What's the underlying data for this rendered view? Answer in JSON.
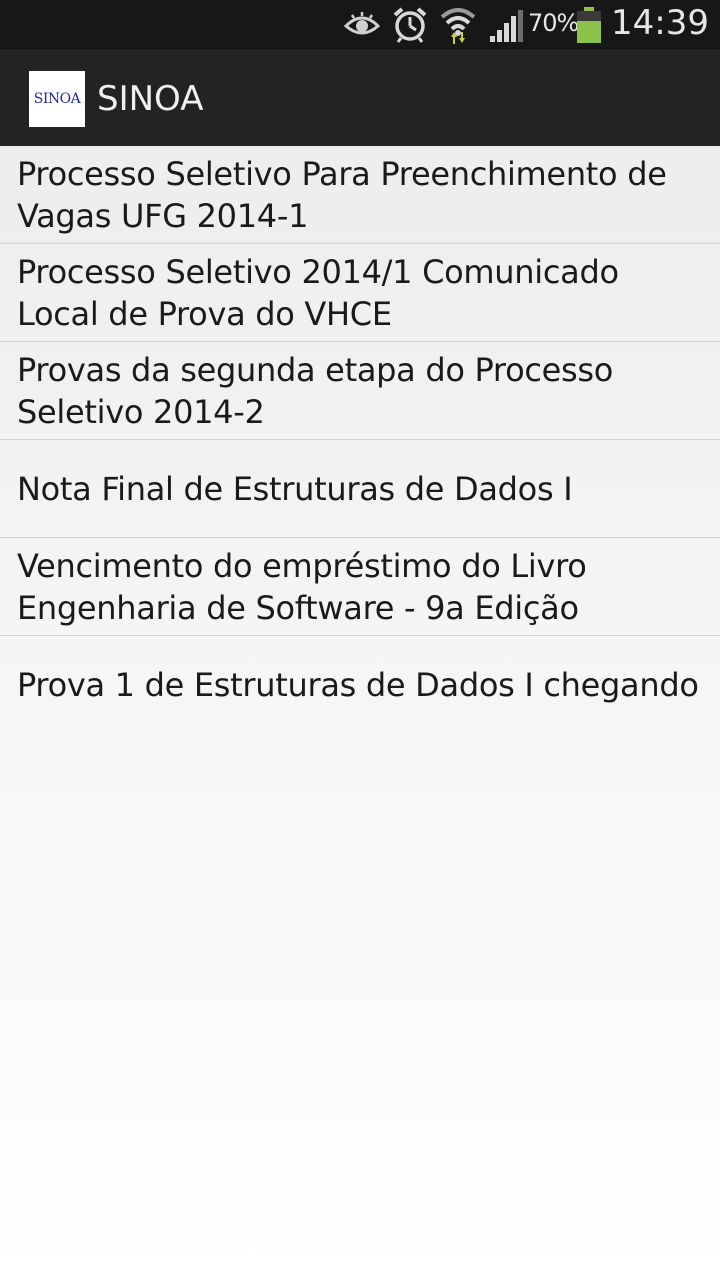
{
  "status_bar": {
    "icons": [
      "eye-icon",
      "alarm-clock-icon",
      "wifi-icon",
      "signal-icon",
      "battery-icon"
    ],
    "battery_percent": "70%",
    "battery_level": 0.7,
    "time": "14:39",
    "battery_color": "#8bc34a"
  },
  "action_bar": {
    "logo_text": "SINOA",
    "title": "SINOA"
  },
  "notices": [
    "Processo Seletivo Para Preenchimento de Vagas UFG 2014-1",
    "Processo Seletivo 2014/1 Comunicado Local de Prova do VHCE",
    "Provas da segunda etapa do Processo Seletivo 2014-2",
    "Nota Final de Estruturas de Dados I",
    "Vencimento do empréstimo do Livro Engenharia de Software - 9a Edição",
    "Prova 1 de Estruturas de Dados I chegando"
  ]
}
